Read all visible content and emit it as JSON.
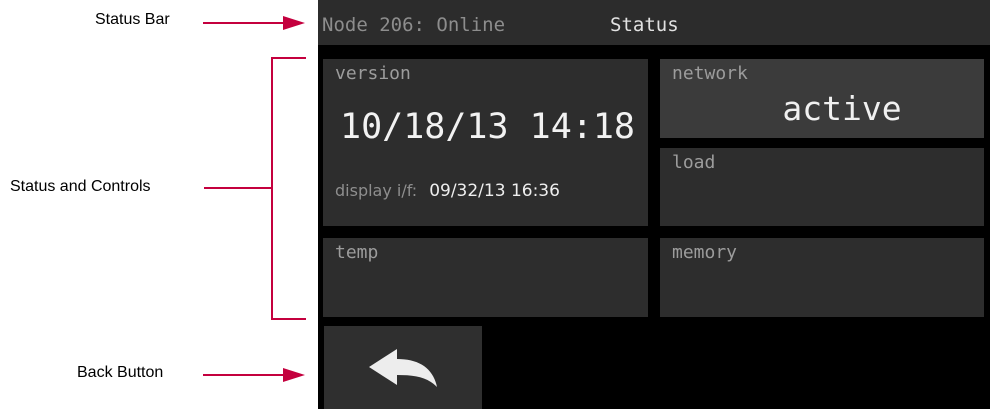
{
  "annotations": {
    "status_bar": "Status Bar",
    "status_controls": "Status and Controls",
    "back_button": "Back Button"
  },
  "status_bar": {
    "node_status": "Node 206: Online",
    "title": "Status"
  },
  "panels": {
    "version": {
      "label": "version",
      "datetime": "10/18/13 14:18",
      "display_label": "display i/f:",
      "display_value": "09/32/13 16:36"
    },
    "network": {
      "label": "network",
      "value": "active"
    },
    "load": {
      "label": "load"
    },
    "temp": {
      "label": "temp"
    },
    "memory": {
      "label": "memory"
    }
  },
  "back_button": {
    "icon": "back-arrow-icon"
  },
  "colors": {
    "annotation_accent": "#c4003e",
    "screen_background": "#000000",
    "panel_background": "#2d2d2d",
    "active_panel_background": "#3b3b3b"
  }
}
